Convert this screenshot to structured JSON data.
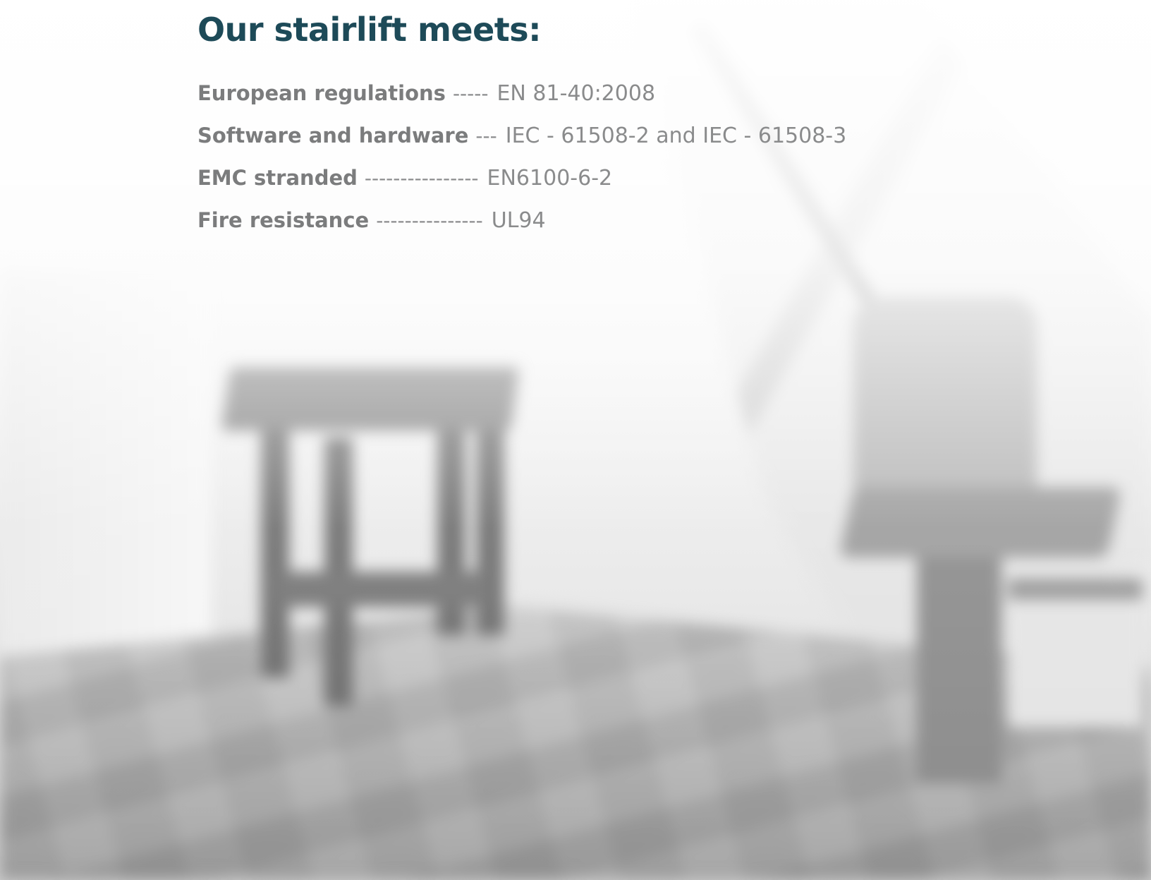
{
  "heading": "Our stairlift meets:",
  "specs": [
    {
      "label": "European regulations",
      "dashes": "-----",
      "value": "EN 81-40:2008"
    },
    {
      "label": "Software and hardware",
      "dashes": "---",
      "value": "IEC - 61508-2 and IEC - 61508-3"
    },
    {
      "label": "EMC stranded",
      "dashes": "----------------",
      "value": "EN6100-6-2"
    },
    {
      "label": "Fire resistance",
      "dashes": "---------------",
      "value": "UL94"
    }
  ],
  "colors": {
    "heading": "#1d4a58",
    "label": "#7b7c7d",
    "value": "#8a8b8c"
  },
  "background_image": "blurred-grayscale-room-with-stairlift-and-side-table"
}
